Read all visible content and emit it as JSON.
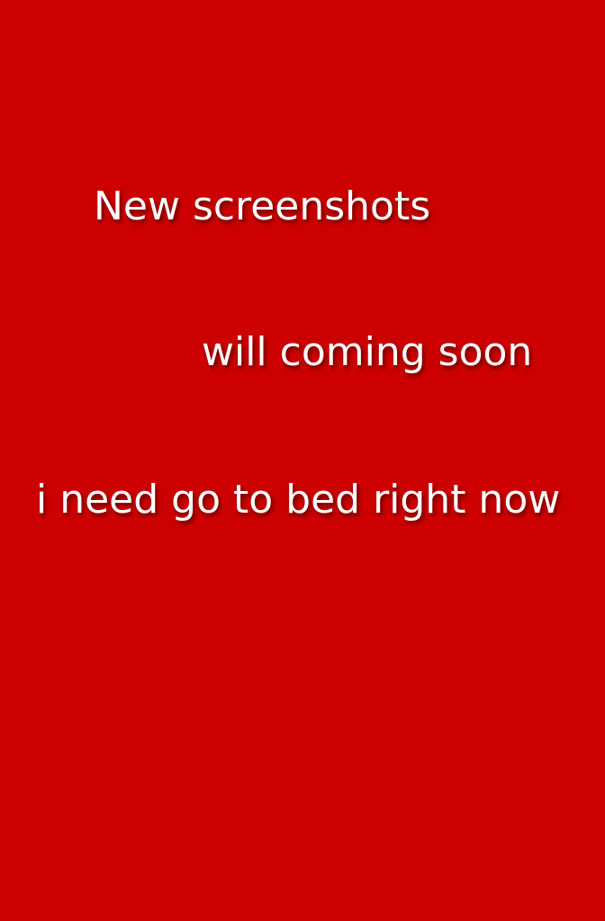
{
  "background_color": "#cc0000",
  "text_color": "#ffffff",
  "lines": [
    "New screenshots",
    "will coming soon",
    "i need go to bed right now"
  ]
}
